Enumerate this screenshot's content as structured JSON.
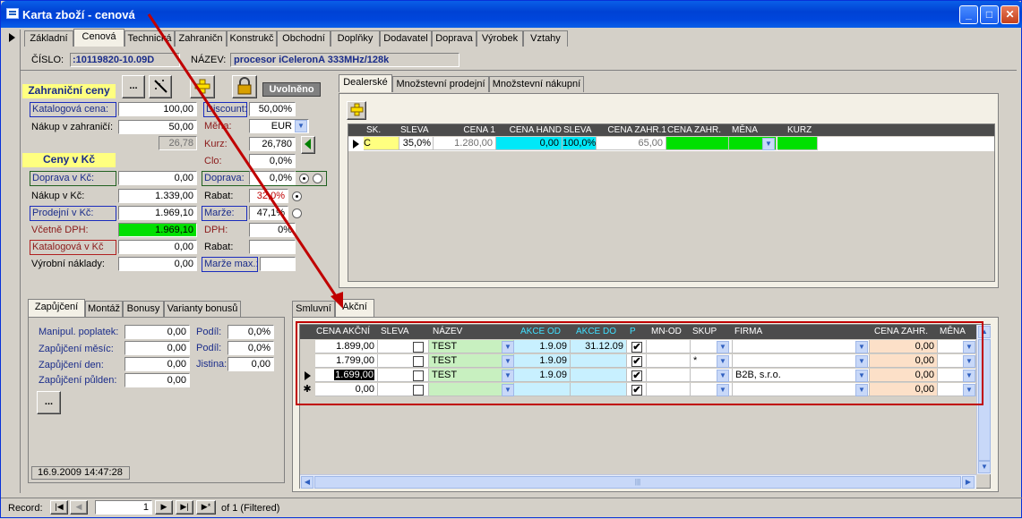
{
  "window": {
    "title": "Karta zboží - cenová",
    "min": "_",
    "max": "□",
    "close": "✕"
  },
  "top_tabs": [
    "Základní",
    "Cenová",
    "Technická",
    "Zahraničn",
    "Konstrukč",
    "Obchodní",
    "Doplňky",
    "Dodavatel",
    "Doprava",
    "Výrobek",
    "Vztahy"
  ],
  "header": {
    "cislo_label": "ČÍSLO:",
    "cislo_value": ":10119820-10.09D",
    "nazev_label": "NÁZEV:",
    "nazev_value": "procesor iCeleronA 333MHz/128k"
  },
  "toolbar": {
    "more_btn": "...",
    "status": "Uvolněno"
  },
  "foreign": {
    "heading": "Zahraniční ceny",
    "katalogova_label": "Katalogová cena:",
    "katalogova_value": "100,00",
    "nakup_label": "Nákup v zahraničí:",
    "nakup_value": "50,00",
    "extra_value": "26,78",
    "discount_label": "Discount:",
    "discount_value": "50,00%",
    "mena_label": "Měna:",
    "mena_value": "EUR",
    "kurz_label": "Kurz:",
    "kurz_value": "26,780",
    "clo_label": "Clo:",
    "clo_value": "0,0%"
  },
  "czk": {
    "heading": "Ceny v Kč",
    "doprava_label": "Doprava v Kč:",
    "doprava_value": "0,00",
    "nakup_label": "Nákup v Kč:",
    "nakup_value": "1.339,00",
    "prodejni_label": "Prodejní v Kč:",
    "prodejni_value": "1.969,10",
    "vcetne_label": "Včetně DPH:",
    "vcetne_value": "1.969,10",
    "katalogova_label": "Katalogová v Kč",
    "katalogova_value": "0,00",
    "vyrobni_label": "Výrobní náklady:",
    "vyrobni_value": "0,00",
    "doprava2_label": "Doprava:",
    "doprava2_value": "0,0%",
    "rabat_label": "Rabat:",
    "rabat_value": "32,0%",
    "marze_label": "Marže:",
    "marze_value": "47,1%",
    "dph_label": "DPH:",
    "dph_value": "0%",
    "rabat2_label": "Rabat:",
    "rabat2_value": "",
    "marzemax_label": "Marže max.:",
    "marzemax_value": ""
  },
  "dealer_tabs": [
    "Dealerské",
    "Množstevní prodejní",
    "Množstevní nákupní"
  ],
  "dealer_grid": {
    "headers": [
      "SK.",
      "SLEVA",
      "CENA 1",
      "CENA HAND",
      "SLEVA",
      "CENA ZAHR.1",
      "CENA ZAHR.",
      "MĚNA",
      "KURZ"
    ],
    "row": {
      "sk": "C",
      "sleva": "35,0%",
      "cena1": "1.280,00",
      "cenahand": "0,00",
      "sleva2": "100,0%",
      "cenazahr1": "65,00"
    }
  },
  "loan_tabs": [
    "Zapůjčení",
    "Montáž",
    "Bonusy",
    "Varianty bonusů"
  ],
  "loan": {
    "manipul_label": "Manipul. poplatek:",
    "manipul_value": "0,00",
    "mesic_label": "Zapůjčení měsíc:",
    "mesic_value": "0,00",
    "den_label": "Zapůjčení den:",
    "den_value": "0,00",
    "pulden_label": "Zapůjčení půlden:",
    "pulden_value": "0,00",
    "podil1_label": "Podíl:",
    "podil1_value": "0,0%",
    "podil2_label": "Podíl:",
    "podil2_value": "0,0%",
    "jistina_label": "Jistina:",
    "jistina_value": "0,00",
    "more_btn": "...",
    "timestamp": "16.9.2009 14:47:28"
  },
  "akce_tabs": [
    "Smluvní",
    "Akční"
  ],
  "akce_grid": {
    "headers": [
      "CENA AKČNÍ",
      "SLEVA",
      "NÁZEV",
      "AKCE OD",
      "AKCE DO",
      "P",
      "MN-OD",
      "SKUP",
      "FIRMA",
      "CENA ZAHR.",
      "MĚNA"
    ],
    "rows": [
      {
        "cena": "1.899,00",
        "nazev": "TEST",
        "od": "1.9.09",
        "do": "31.12.09",
        "p": true,
        "skup": "",
        "firma": "",
        "zahr": "0,00"
      },
      {
        "cena": "1.799,00",
        "nazev": "TEST",
        "od": "1.9.09",
        "do": "",
        "p": true,
        "skup": "*",
        "firma": "",
        "zahr": "0,00"
      },
      {
        "cena": "1.699,00",
        "nazev": "TEST",
        "od": "1.9.09",
        "do": "",
        "p": true,
        "skup": "",
        "firma": "B2B, s.r.o.",
        "zahr": "0,00"
      },
      {
        "cena": "0,00",
        "nazev": "",
        "od": "",
        "do": "",
        "p": true,
        "skup": "",
        "firma": "",
        "zahr": "0,00"
      }
    ]
  },
  "record_nav": {
    "label": "Record:",
    "current": "1",
    "of_text": "of  1 (Filtered)"
  },
  "colors": {
    "title_blue": "#0046dc",
    "heading_yellow": "#ffff80",
    "green": "#00e000",
    "cyan": "#00e8f8",
    "annotation_red": "#c00000"
  }
}
